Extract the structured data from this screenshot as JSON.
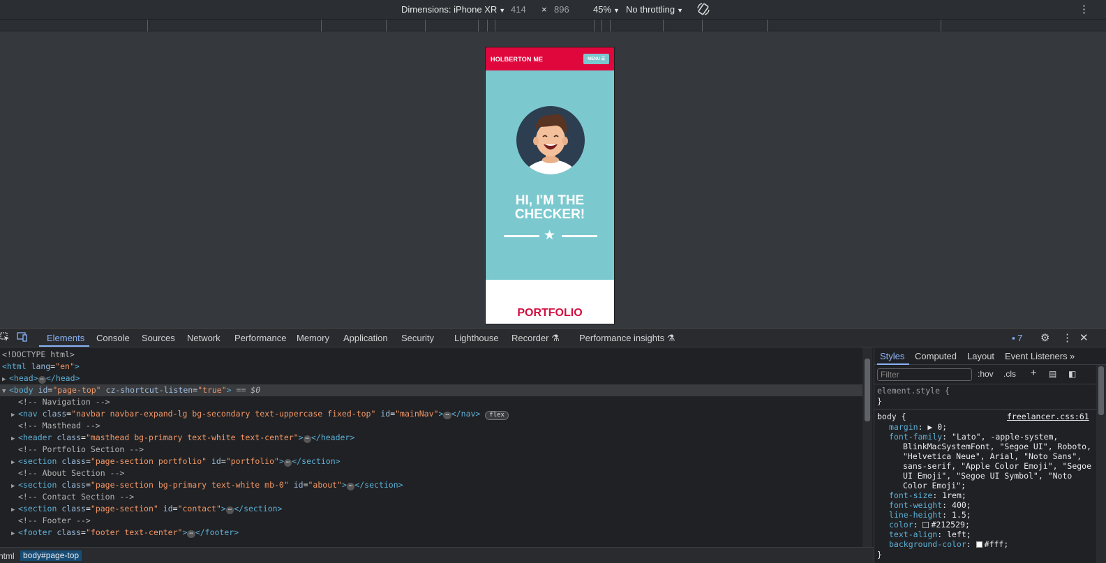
{
  "device_toolbar": {
    "dimensions_label": "Dimensions: iPhone XR",
    "width": "414",
    "times": "×",
    "height": "896",
    "zoom": "45%",
    "throttling": "No throttling"
  },
  "page": {
    "brand": "HOLBERTON ME",
    "menu_label": "MENU ☰",
    "hero_title_line1": "HI, I'M THE",
    "hero_title_line2": "CHECKER!",
    "portfolio_heading": "PORTFOLIO",
    "colors": {
      "nav": "#e0073d",
      "masthead": "#7bc9cf",
      "portfolio": "#d10f3f"
    }
  },
  "devtools": {
    "tabs": [
      "Elements",
      "Console",
      "Sources",
      "Network",
      "Performance",
      "Memory",
      "Application",
      "Security",
      "Lighthouse",
      "Recorder",
      "Performance insights"
    ],
    "issues_count": "7",
    "dom": {
      "doctype": "<!DOCTYPE html>",
      "html_open": "<html",
      "html_attr": "lang",
      "html_val": "\"en\"",
      "head": "<head>",
      "head_close": "</head>",
      "body_tag": "<body",
      "body_id_attr": "id",
      "body_id_val": "\"page-top\"",
      "body_cz_attr": "cz-shortcut-listen",
      "body_cz_val": "\"true\"",
      "body_marker": "== $0",
      "comments": [
        "<!-- Navigation -->",
        "<!-- Masthead -->",
        "<!-- Portfolio Section -->",
        "<!-- About Section -->",
        "<!-- Contact Section -->",
        "<!-- Footer -->"
      ],
      "nav_class": "\"navbar navbar-expand-lg bg-secondary text-uppercase fixed-top\"",
      "nav_id": "\"mainNav\"",
      "nav_badge": "flex",
      "header_class": "\"masthead bg-primary text-white text-center\"",
      "portfolio_class": "\"page-section portfolio\"",
      "portfolio_id": "\"portfolio\"",
      "about_class": "\"page-section bg-primary text-white mb-0\"",
      "about_id": "\"about\"",
      "contact_class": "\"page-section\"",
      "contact_id": "\"contact\"",
      "footer_class": "\"footer text-center\""
    },
    "breadcrumbs": [
      "html",
      "body#page-top"
    ],
    "styles_tabs": [
      "Styles",
      "Computed",
      "Layout",
      "Event Listeners"
    ],
    "filter_placeholder": "Filter",
    "hov": ":hov",
    "cls": ".cls",
    "element_style": "element.style {",
    "close_brace": "}",
    "body_rule": "body {",
    "source_link": "freelancer.css:61",
    "props": {
      "margin": "margin",
      "margin_val": "▶ 0;",
      "font_family": "font-family",
      "font_family_val_1": "\"Lato\", -apple-system,",
      "font_family_val_2": "BlinkMacSystemFont, \"Segoe UI\", Roboto,",
      "font_family_val_3": "\"Helvetica Neue\", Arial, \"Noto Sans\",",
      "font_family_val_4": "sans-serif, \"Apple Color Emoji\", \"Segoe",
      "font_family_val_5": "UI Emoji\", \"Segoe UI Symbol\", \"Noto",
      "font_family_val_6": "Color Emoji\";",
      "font_size": "font-size",
      "font_size_val": "1rem;",
      "font_weight": "font-weight",
      "font_weight_val": "400;",
      "line_height": "line-height",
      "line_height_val": "1.5;",
      "color": "color",
      "color_val": "#212529;",
      "text_align": "text-align",
      "text_align_val": "left;",
      "background_color": "background-color",
      "background_color_val": "#fff;"
    }
  }
}
